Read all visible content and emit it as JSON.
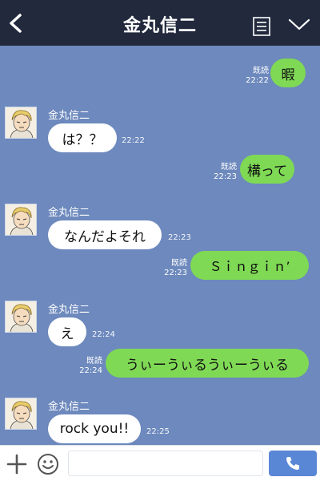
{
  "header": {
    "title": "金丸信二",
    "icons": {
      "back": "chevron-left-icon",
      "menu": "note-list-icon",
      "collapse": "chevron-down-icon"
    },
    "background": "#22293d"
  },
  "chat": {
    "background": "#6d89bd",
    "outgoing_color": "#7fd955",
    "incoming_color": "#ffffff",
    "messages": [
      {
        "direction": "outgoing",
        "text": "暇",
        "read_label": "既読",
        "time": "22:22"
      },
      {
        "direction": "incoming",
        "sender": "金丸信二",
        "text": "は？？",
        "time": "22:22"
      },
      {
        "direction": "outgoing",
        "text": "構って",
        "read_label": "既読",
        "time": "22:23"
      },
      {
        "direction": "incoming",
        "sender": "金丸信二",
        "text": "なんだよそれ",
        "time": "22:23"
      },
      {
        "direction": "outgoing",
        "text": "Ｓｉｎｇｉｎ’",
        "read_label": "既読",
        "time": "22:23"
      },
      {
        "direction": "incoming",
        "sender": "金丸信二",
        "text": "え",
        "time": "22:24"
      },
      {
        "direction": "outgoing",
        "text": "うぃーうぃるうぃーうぃる",
        "read_label": "既読",
        "time": "22:24"
      },
      {
        "direction": "incoming",
        "sender": "金丸信二",
        "text": "rock you!!",
        "time": "22:25"
      }
    ]
  },
  "input_bar": {
    "message_value": "",
    "icons": {
      "add": "plus-icon",
      "sticker": "smile-icon",
      "call": "phone-icon"
    },
    "call_color": "#5a86d6"
  }
}
